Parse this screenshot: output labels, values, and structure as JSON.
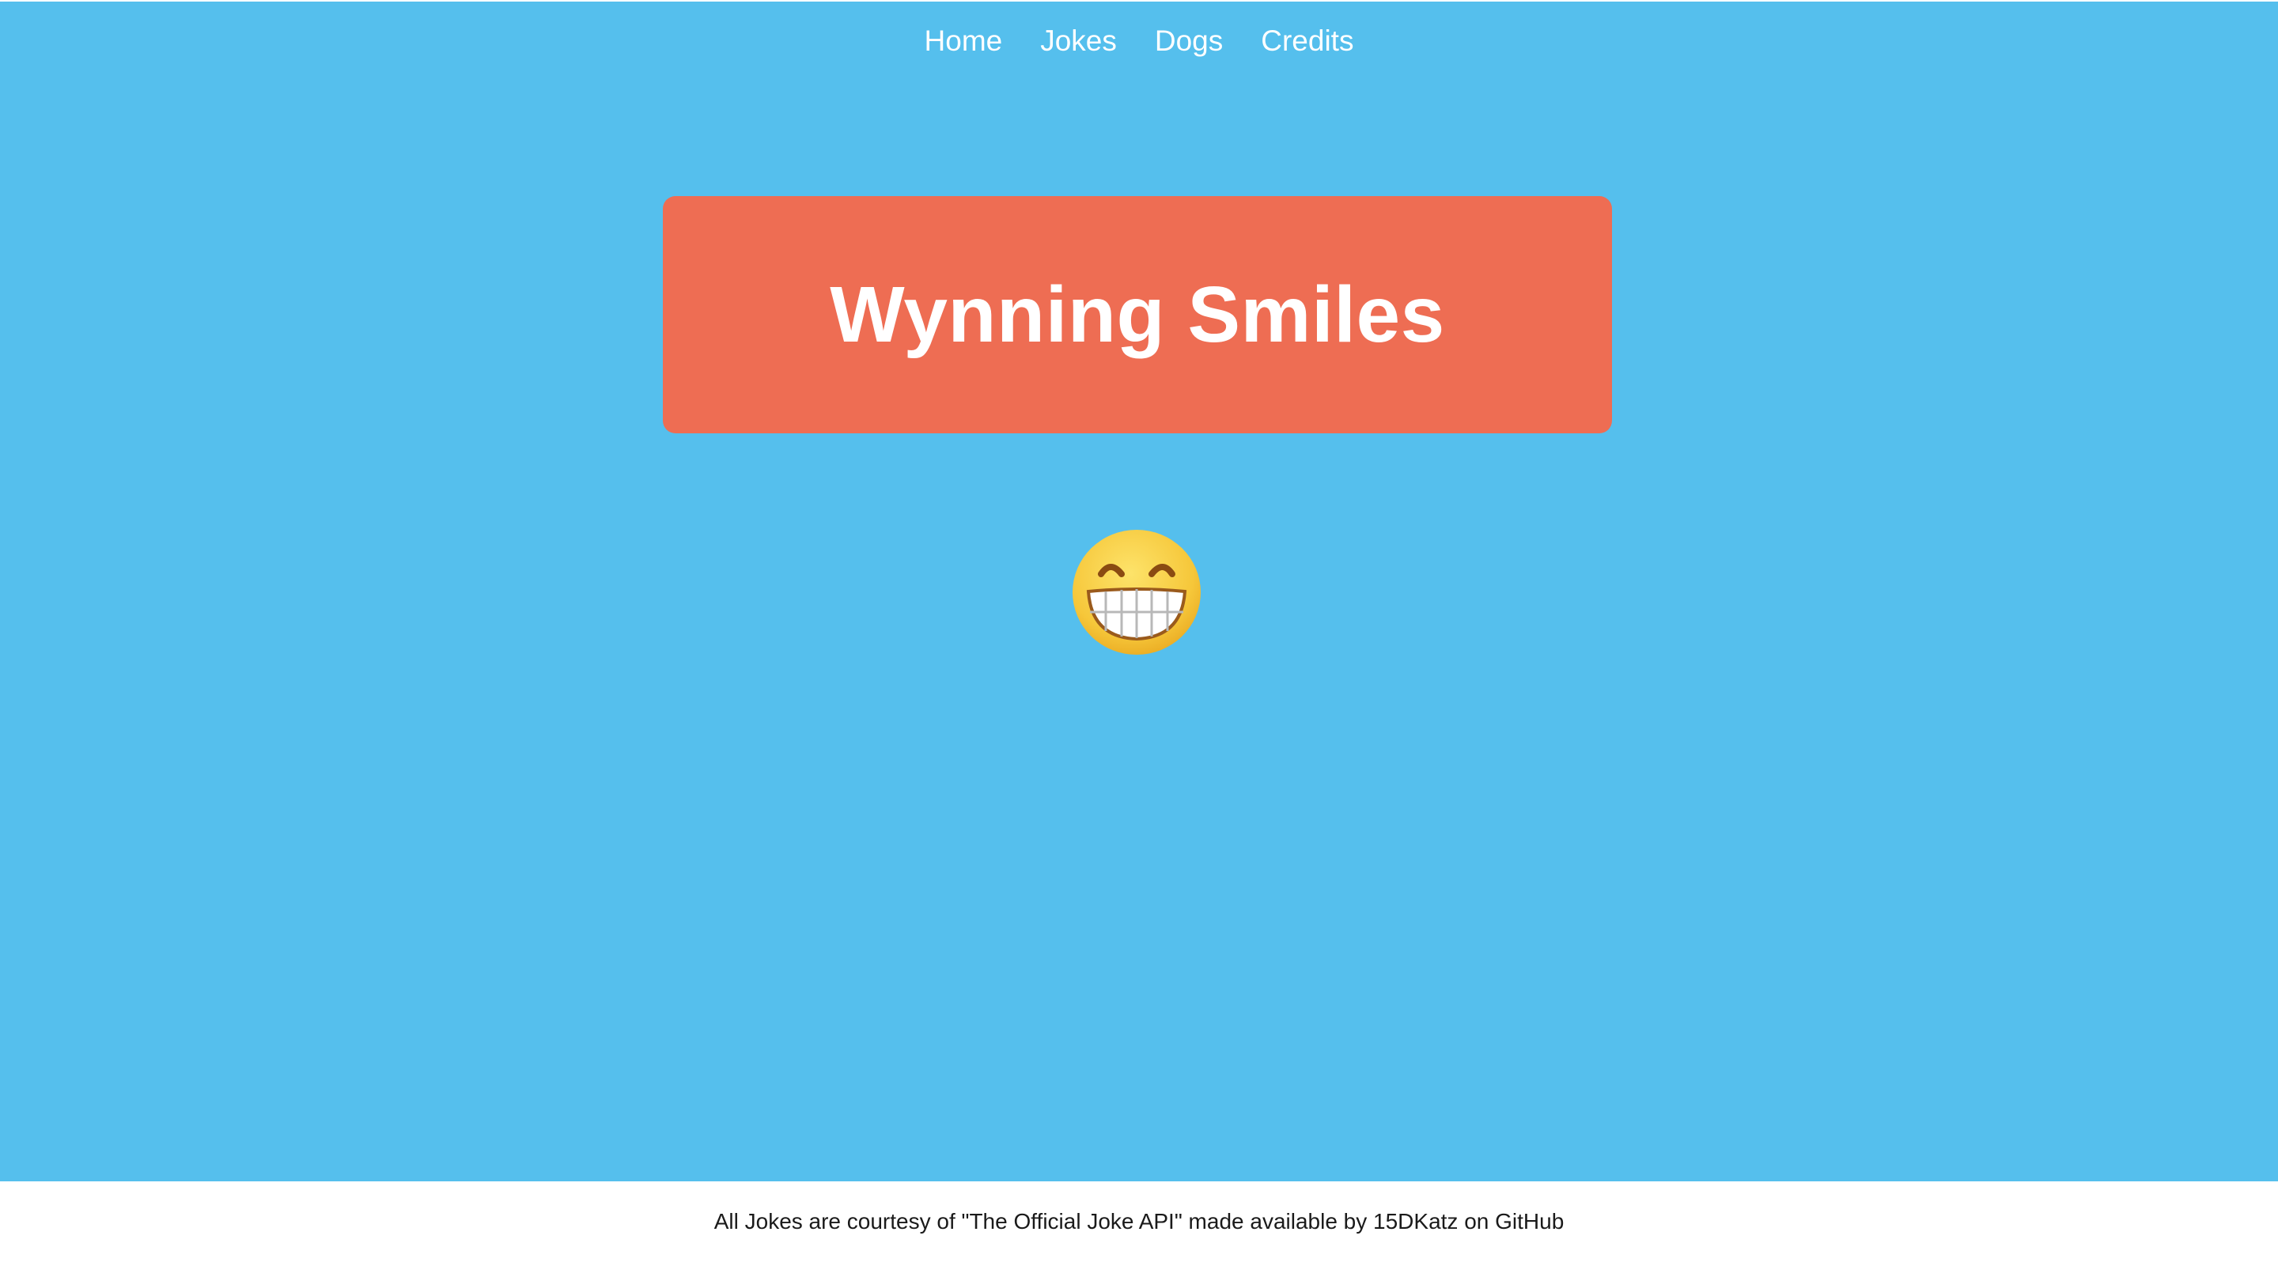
{
  "nav": {
    "items": [
      {
        "label": "Home"
      },
      {
        "label": "Jokes"
      },
      {
        "label": "Dogs"
      },
      {
        "label": "Credits"
      }
    ]
  },
  "hero": {
    "title": "Wynning Smiles",
    "emoji_icon": "grinning-face-with-smiling-eyes-icon"
  },
  "footer": {
    "text": "All Jokes are courtesy of \"The Official Joke API\" made available by 15DKatz on GitHub"
  },
  "colors": {
    "background": "#55bfed",
    "banner": "#ee6d53",
    "text_light": "#ffffff",
    "footer_background": "#ffffff"
  }
}
